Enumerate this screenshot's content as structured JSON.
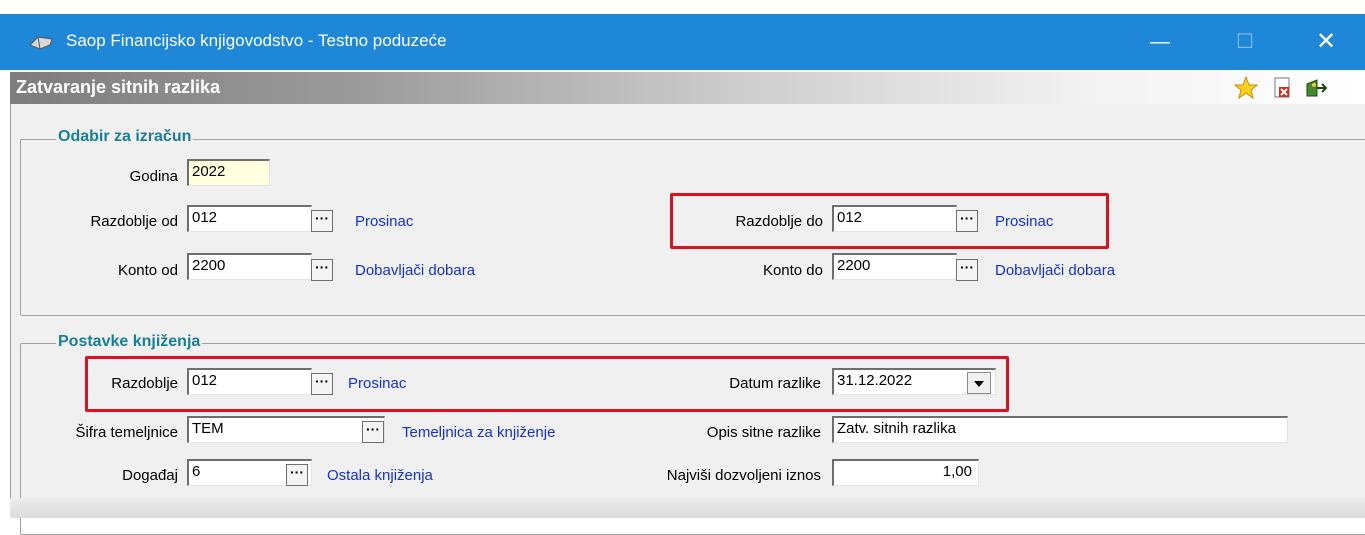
{
  "window": {
    "title": "Saop Financijsko knjigovodstvo - Testno poduzeće",
    "minimize": "—",
    "maximize": "☐",
    "close": "✕"
  },
  "form": {
    "title": "Zatvaranje sitnih razlika",
    "toolbar_icons": [
      "star-icon",
      "pdf-close-icon",
      "exit-icon"
    ]
  },
  "group1": {
    "legend": "Odabir za izračun",
    "godina": {
      "label": "Godina",
      "value": "2022"
    },
    "razdoblje_od": {
      "label": "Razdoblje od",
      "value": "012",
      "desc": "Prosinac"
    },
    "razdoblje_do": {
      "label": "Razdoblje do",
      "value": "012",
      "desc": "Prosinac"
    },
    "konto_od": {
      "label": "Konto od",
      "value": "2200",
      "desc": "Dobavljači dobara"
    },
    "konto_do": {
      "label": "Konto do",
      "value": "2200",
      "desc": "Dobavljači dobara"
    }
  },
  "group2": {
    "legend": "Postavke knjiženja",
    "razdoblje": {
      "label": "Razdoblje",
      "value": "012",
      "desc": "Prosinac"
    },
    "datum_razlike": {
      "label": "Datum razlike",
      "value": "31.12.2022"
    },
    "sifra_temeljnice": {
      "label": "Šifra temeljnice",
      "value": "TEM",
      "desc": "Temeljnica za knjiženje"
    },
    "opis_sitne_razlike": {
      "label": "Opis sitne razlike",
      "value": "Zatv. sitnih razlika"
    },
    "dogadaj": {
      "label": "Događaj",
      "value": "6",
      "desc": "Ostala knjiženja"
    },
    "najvisi_iznos": {
      "label": "Najviši dozvoljeni iznos",
      "value": "1,00"
    }
  },
  "ellipsis": "···",
  "colors": {
    "titlebar": "#1f87d8",
    "link": "#1432d2",
    "legend": "#1a7e96",
    "highlight": "#e1101f"
  }
}
